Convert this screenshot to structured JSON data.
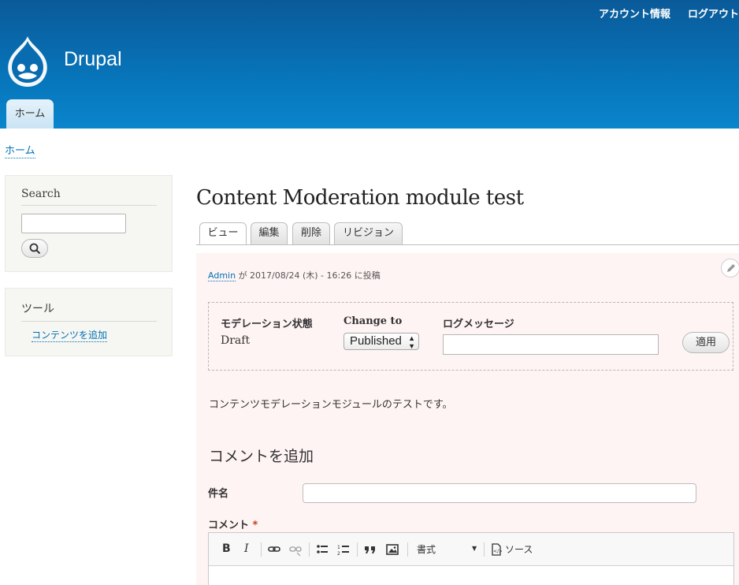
{
  "header": {
    "secondary_menu": [
      "アカウント情報",
      "ログアウト"
    ],
    "site_name": "Drupal",
    "main_menu": [
      "ホーム"
    ]
  },
  "breadcrumb": [
    "ホーム"
  ],
  "sidebar": {
    "search": {
      "title": "Search",
      "button_icon": "search-icon"
    },
    "tools": {
      "title": "ツール",
      "links": [
        "コンテンツを追加"
      ]
    }
  },
  "page": {
    "title": "Content Moderation module test",
    "tabs": [
      {
        "label": "ビュー",
        "active": true
      },
      {
        "label": "編集",
        "active": false
      },
      {
        "label": "削除",
        "active": false
      },
      {
        "label": "リビジョン",
        "active": false
      }
    ]
  },
  "node": {
    "author": "Admin",
    "submitted_suffix": "が 2017/08/24 (木) - 16:26 に投稿",
    "moderation": {
      "state_label": "モデレーション状態",
      "state_value": "Draft",
      "change_label": "Change to",
      "change_value": "Published",
      "log_label": "ログメッセージ",
      "log_value": "",
      "apply_label": "適用"
    },
    "body": "コンテンツモデレーションモジュールのテストです。"
  },
  "comment_form": {
    "heading": "コメントを追加",
    "subject_label": "件名",
    "subject_value": "",
    "comment_label": "コメント",
    "required_mark": "*",
    "toolbar": {
      "bold": "B",
      "italic": "I",
      "format_label": "書式",
      "source_label": "ソース"
    }
  },
  "colors": {
    "header_blue": "#0779bf",
    "link": "#0071b3",
    "node_background": "#fff4f4",
    "sidebar_background": "#f6f6f2"
  }
}
